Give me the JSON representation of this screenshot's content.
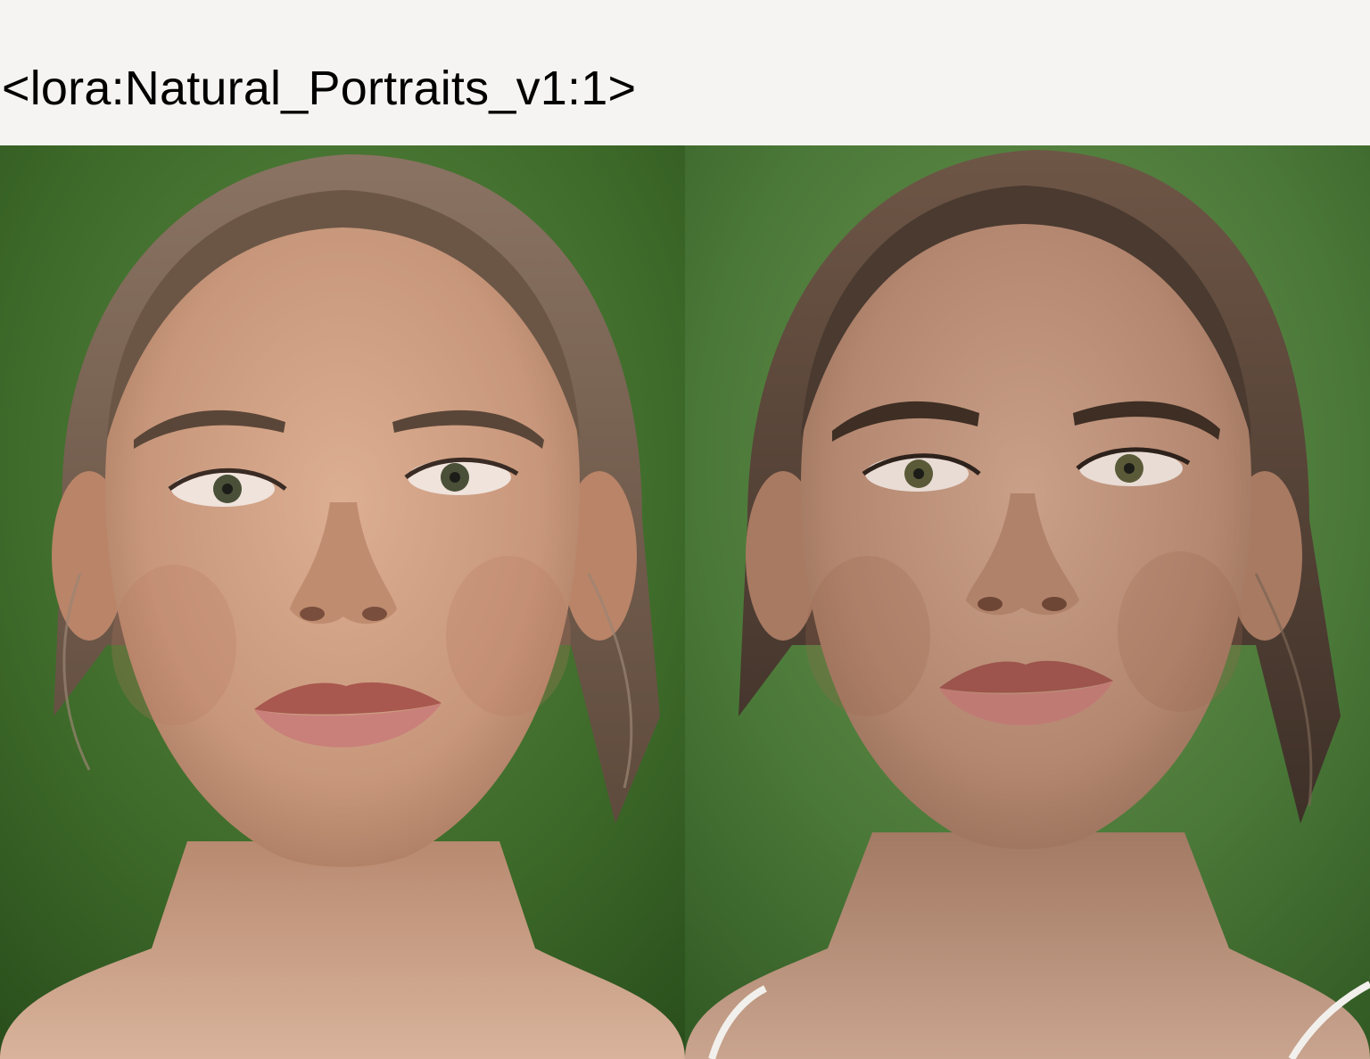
{
  "header": {
    "caption": "<lora:Natural_Portraits_v1:1>"
  },
  "images": [
    {
      "id": "left",
      "icon": "portrait-photo-icon",
      "colors": {
        "bg": "#3f6e2c",
        "skin": "#c9997e",
        "hair": "#6b5646",
        "lips": "#b5655b"
      }
    },
    {
      "id": "right",
      "icon": "portrait-photo-icon",
      "colors": {
        "bg": "#4c7a3a",
        "skin": "#b98a70",
        "hair": "#4a3a30",
        "lips": "#a8605a"
      }
    }
  ]
}
